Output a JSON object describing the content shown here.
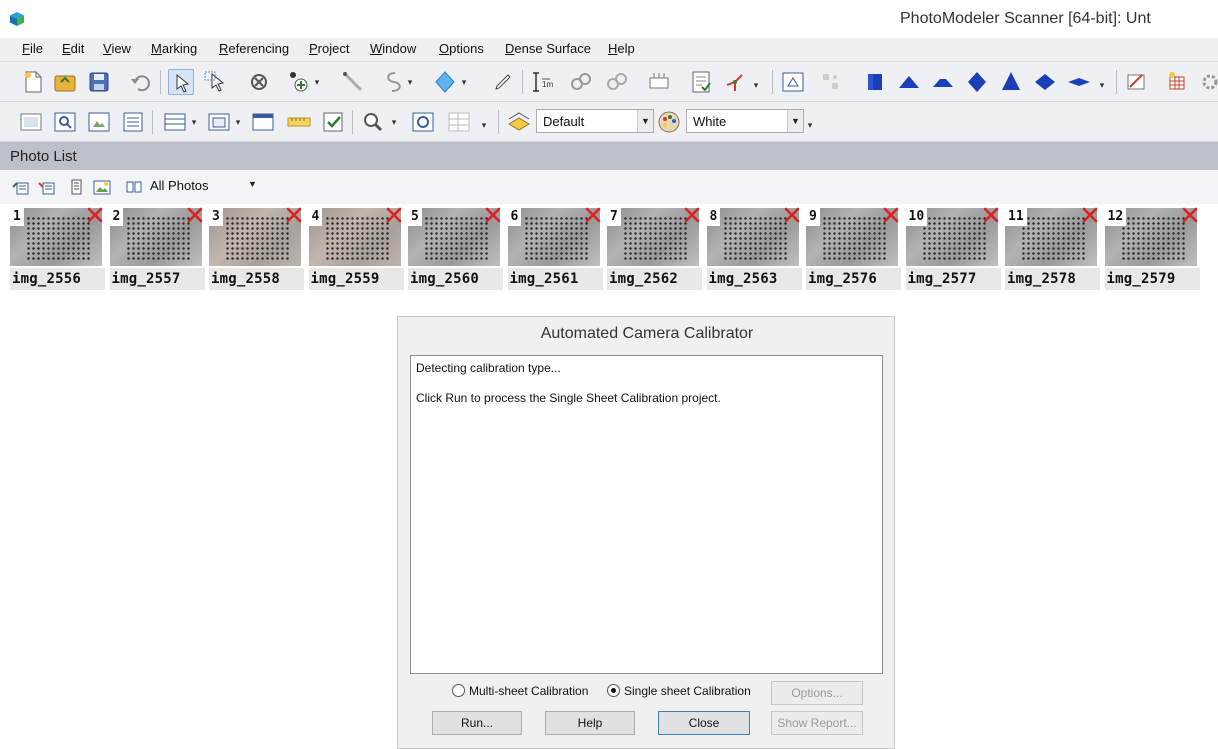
{
  "window": {
    "title": "PhotoModeler Scanner [64-bit]: Unt",
    "app_icon": "photomodeler-cube-icon"
  },
  "menu": [
    {
      "label": "File",
      "key": "F",
      "rest": "ile"
    },
    {
      "label": "Edit",
      "key": "E",
      "rest": "dit"
    },
    {
      "label": "View",
      "key": "V",
      "rest": "iew"
    },
    {
      "label": "Marking",
      "key": "M",
      "rest": "arking"
    },
    {
      "label": "Referencing",
      "key": "R",
      "rest": "eferencing"
    },
    {
      "label": "Project",
      "key": "P",
      "rest": "roject"
    },
    {
      "label": "Window",
      "key": "W",
      "rest": "indow"
    },
    {
      "label": "Options",
      "key": "O",
      "rest": "ptions"
    },
    {
      "label": "Dense Surface",
      "key": "D",
      "rest": "ense Surface"
    },
    {
      "label": "Help",
      "key": "H",
      "rest": "elp"
    }
  ],
  "toolbar": {
    "view_mode": "Default",
    "background_color": "White"
  },
  "photo_list": {
    "title": "Photo List",
    "filter": "All Photos",
    "photos": [
      {
        "number": "1",
        "name": "img_2556"
      },
      {
        "number": "2",
        "name": "img_2557"
      },
      {
        "number": "3",
        "name": "img_2558"
      },
      {
        "number": "4",
        "name": "img_2559"
      },
      {
        "number": "5",
        "name": "img_2560"
      },
      {
        "number": "6",
        "name": "img_2561"
      },
      {
        "number": "7",
        "name": "img_2562"
      },
      {
        "number": "8",
        "name": "img_2563"
      },
      {
        "number": "9",
        "name": "img_2576"
      },
      {
        "number": "10",
        "name": "img_2577"
      },
      {
        "number": "11",
        "name": "img_2578"
      },
      {
        "number": "12",
        "name": "img_2579"
      }
    ]
  },
  "dialog": {
    "title": "Automated Camera Calibrator",
    "log": [
      "Detecting calibration type...",
      "Click Run to process the Single Sheet Calibration project."
    ],
    "radio_multi": "Multi-sheet Calibration",
    "radio_single": "Single sheet Calibration",
    "selected": "single",
    "options_button": "Options...",
    "run_button": "Run...",
    "help_button": "Help",
    "close_button": "Close",
    "report_button": "Show Report..."
  },
  "colors": {
    "toolbar_bg": "#eef0f4",
    "panel_header": "#bcc1c9",
    "unprocessed_x": "#e02020",
    "solid_blue": "#1c3fb8"
  }
}
